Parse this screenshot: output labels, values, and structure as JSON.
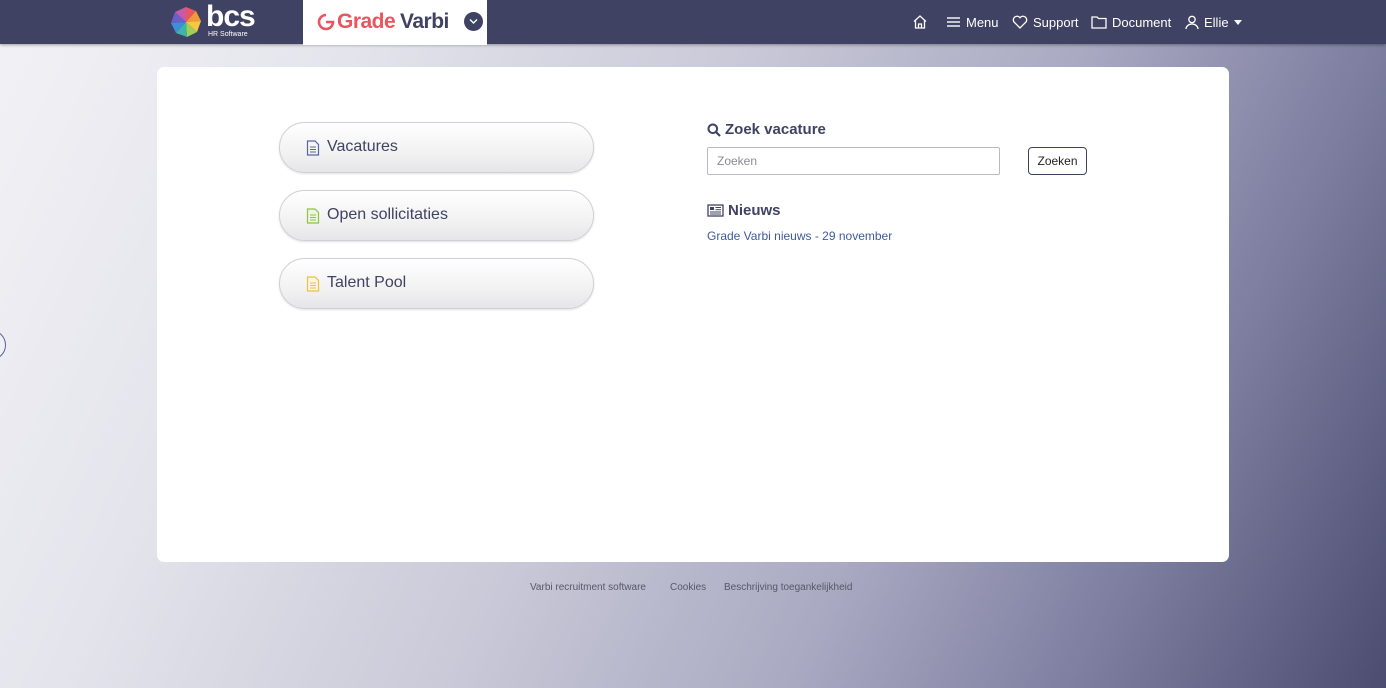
{
  "header": {
    "brand_name": "bcs",
    "brand_sub": "HR Software",
    "product_name_1": "Grade",
    "product_name_2": "Varbi",
    "nav": {
      "home_icon": "home-icon",
      "menu_label": "Menu",
      "support_label": "Support",
      "document_label": "Document",
      "user_label": "Ellie"
    },
    "colors": {
      "bar": "#3f4262",
      "grade_red": "#e8565e"
    }
  },
  "main": {
    "menu_buttons": [
      {
        "label": "Vacatures",
        "icon": "document-icon",
        "icon_color": "#5a63a8"
      },
      {
        "label": "Open sollicitaties",
        "icon": "document-icon",
        "icon_color": "#8cc34a"
      },
      {
        "label": "Talent Pool",
        "icon": "document-icon",
        "icon_color": "#e8c14a"
      }
    ],
    "search": {
      "title": "Zoek vacature",
      "placeholder": "Zoeken",
      "value": "",
      "button_label": "Zoeken"
    },
    "news": {
      "title": "Nieuws",
      "items": [
        "Grade Varbi nieuws - 29 november"
      ]
    }
  },
  "footer": {
    "links": [
      "Varbi recruitment software",
      "Cookies",
      "Beschrijving toegankelijkheid"
    ]
  }
}
